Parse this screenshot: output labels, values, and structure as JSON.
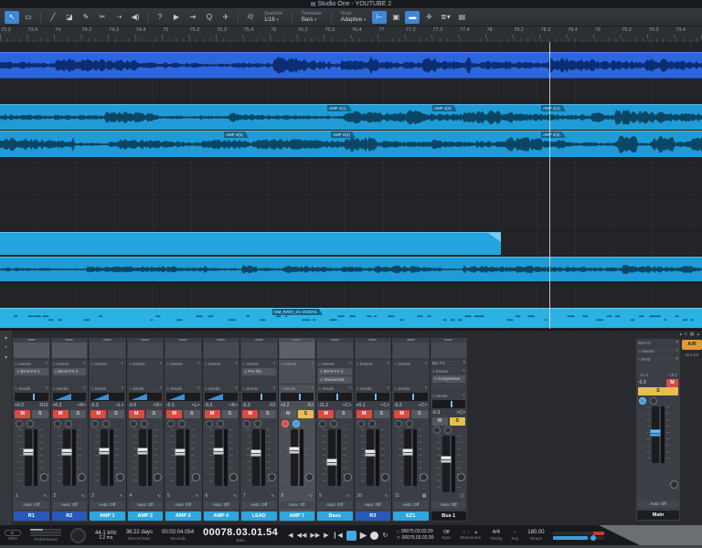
{
  "window": {
    "title": "Studio One - YOUTUBE 2"
  },
  "toolbar": {
    "quantize_label": "Quantize",
    "quantize_value": "1/16",
    "timebase_label": "Timebase",
    "timebase_value": "Bars",
    "snap_label": "Snap",
    "snap_value": "Adaptive",
    "iq_label": "iQ"
  },
  "ruler": {
    "labels": [
      "73.3",
      "73.4",
      "74",
      "74.2",
      "74.3",
      "74.4",
      "75",
      "75.2",
      "75.3",
      "75.4",
      "76",
      "76.2",
      "76.3",
      "76.4",
      "77",
      "77.2",
      "77.3",
      "77.4",
      "78",
      "78.2",
      "78.3",
      "78.4",
      "79",
      "79.2",
      "79.3",
      "79.4"
    ]
  },
  "arrange": {
    "track2_labels": [
      "AMP 1(1)",
      "AMP 4(3)",
      "AMP 1(1)"
    ],
    "track3_labels": [
      "AMP 4(5)",
      "AMP 2(3)",
      "AMP 2(3)"
    ],
    "track6_label": "GM_RATA_VL VOICH1"
  },
  "mixer": {
    "labels": {
      "inserts": "Inserts",
      "sends": "Sends",
      "mixfx": "Mix FX",
      "mute": "M",
      "solo": "S",
      "auto": "Auto: Off",
      "post": "Post"
    },
    "channels": [
      {
        "num": "1",
        "name": "R1",
        "color": "#2859b8",
        "header": "light",
        "inserts": [
          "BIAS FX 2"
        ],
        "gain": "+0.2",
        "pan": "R15",
        "pan_shape": "line",
        "mute": true,
        "solo": false,
        "rec": false,
        "mon": false,
        "fader": 0.68,
        "type": "audio"
      },
      {
        "num": "2",
        "name": "R2",
        "color": "#2859b8",
        "header": "light",
        "inserts": [
          "BIAS FX 2"
        ],
        "gain": "+0.2",
        "pan": "<R>",
        "pan_shape": "ramp",
        "mute": true,
        "solo": false,
        "rec": false,
        "mon": false,
        "fader": 0.68,
        "type": "audio"
      },
      {
        "num": "3",
        "name": "AMP 1",
        "color": "#2fa6dd",
        "inserts": [],
        "gain": "-0.3",
        "pan": "<L>",
        "pan_shape": "ramp",
        "mute": true,
        "solo": false,
        "rec": false,
        "mon": false,
        "fader": 0.7,
        "type": "audio"
      },
      {
        "num": "4",
        "name": "AMP 2",
        "color": "#2fa6dd",
        "inserts": [],
        "gain": "-0.5",
        "pan": "<R>",
        "pan_shape": "ramp",
        "mute": true,
        "solo": false,
        "rec": false,
        "mon": false,
        "fader": 0.7,
        "type": "audio"
      },
      {
        "num": "5",
        "name": "AMP 3",
        "color": "#2fa6dd",
        "inserts": [],
        "gain": "-0.3",
        "pan": "<L>",
        "pan_shape": "ramp",
        "mute": true,
        "solo": false,
        "rec": false,
        "mon": false,
        "fader": 0.69,
        "type": "audio"
      },
      {
        "num": "6",
        "name": "AMP 4",
        "color": "#2fa6dd",
        "inserts": [],
        "gain": "-0.3",
        "pan": "<R>",
        "pan_shape": "ramp",
        "mute": true,
        "solo": false,
        "rec": false,
        "mon": false,
        "fader": 0.7,
        "type": "audio"
      },
      {
        "num": "7",
        "name": "LEAD",
        "color": "#2fa6dd",
        "inserts": [
          "Pro G5"
        ],
        "gain": "-0.3",
        "pan": "R2",
        "pan_shape": "line",
        "mute": true,
        "solo": false,
        "rec": false,
        "mon": false,
        "fader": 0.67,
        "type": "audio"
      },
      {
        "num": "8",
        "name": "AMP 7",
        "color": "#2fa6dd",
        "selected": true,
        "inserts": [],
        "gain": "+0.2",
        "pan": "R2",
        "pan_shape": "line",
        "mute": false,
        "solo": true,
        "rec": true,
        "mon": true,
        "fader": 0.72,
        "type": "audio"
      },
      {
        "num": "9",
        "name": "Bass",
        "color": "#2fa6dd",
        "inserts": [
          "BIAS FX 2",
          "StudioDela"
        ],
        "gain": "-11.2",
        "pan": "<C>",
        "pan_shape": "line",
        "mute": true,
        "solo": false,
        "rec": false,
        "mon": false,
        "fader": 0.45,
        "type": "audio"
      },
      {
        "num": "10",
        "name": "R3",
        "color": "#2859b8",
        "inserts": [],
        "gain": "+0.1",
        "pan": "<C>",
        "pan_shape": "line",
        "mute": true,
        "solo": false,
        "rec": false,
        "mon": false,
        "fader": 0.66,
        "type": "audio"
      },
      {
        "num": "11",
        "name": "EZ1",
        "color": "#2fa6dd",
        "inserts": [],
        "gain": "-0.2",
        "pan": "<C>",
        "pan_shape": "line",
        "mute": true,
        "solo": false,
        "rec": false,
        "mon": false,
        "fader": 0.69,
        "type": "instrument"
      },
      {
        "num": "",
        "name": "Bus 1",
        "color": "#17191d",
        "mixfx": true,
        "inserts": [
          "Compressor"
        ],
        "gain": "-0.3",
        "pan": "<C>",
        "pan_shape": "line",
        "mute": false,
        "solo": true,
        "rec": false,
        "mon": false,
        "fader": 0.66,
        "type": "bus"
      }
    ],
    "main": {
      "name": "Main",
      "meter_left": "-10.3",
      "meter_right": "-10.7",
      "gain": "-0.3",
      "fader": 0.6
    },
    "ab_button": "A/B",
    "out_label": "Out 1/2"
  },
  "transport": {
    "midi_label": "MIDI",
    "performance_label": "Performance",
    "sample_rate": "44.1 kHz",
    "latency": "2.2 ms",
    "record_max_value": "36:22 days",
    "record_max_label": "Record Max",
    "seconds_value": "00:02:04.054",
    "seconds_label": "Seconds",
    "bars_value": "00078.03.01.54",
    "bars_label": "Bars",
    "l_label": "L",
    "loop_l": "00075.03.02.00",
    "r_label": "R",
    "loop_r": "00075.03.02.00",
    "sync_value": "Off",
    "sync_label": "Sync",
    "metronome_label": "Metronome",
    "timing_value": "4/4",
    "timing_label": "Timing",
    "key_value": "-",
    "key_label": "Key",
    "tempo_value": "180.00",
    "tempo_label": "Tempo"
  }
}
